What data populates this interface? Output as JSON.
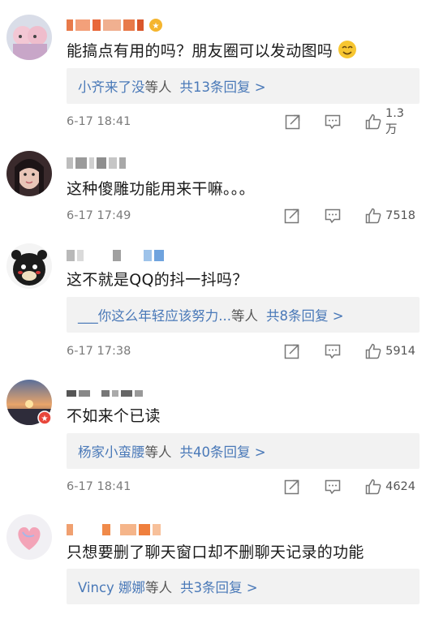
{
  "comments": [
    {
      "text": "能搞点有用的吗？朋友圈可以发动图吗",
      "has_emoji": true,
      "reply_users": "小齐来了没",
      "reply_suffix": "等人",
      "reply_count": "共13条回复 >",
      "time": "6-17 18:41",
      "likes": "1.3万"
    },
    {
      "text": "这种傻雕功能用来干嘛。。。",
      "has_emoji": false,
      "reply_users": "",
      "reply_suffix": "",
      "reply_count": "",
      "time": "6-17 17:49",
      "likes": "7518"
    },
    {
      "text": "这不就是QQ的抖一抖吗？",
      "has_emoji": false,
      "reply_users": "___你这么年轻应该努力...",
      "reply_suffix": "等人",
      "reply_count": "共8条回复 >",
      "time": "6-17 17:38",
      "likes": "5914"
    },
    {
      "text": "不如来个已读",
      "has_emoji": false,
      "reply_users": "杨家小蛮腰",
      "reply_suffix": "等人",
      "reply_count": "共40条回复 >",
      "time": "6-17 18:41",
      "likes": "4624"
    },
    {
      "text": "只想要删了聊天窗口却不删聊天记录的功能",
      "has_emoji": false,
      "reply_users": "Vincy 娜娜",
      "reply_suffix": "等人",
      "reply_count": "共3条回复 >",
      "time": "",
      "likes": ""
    }
  ],
  "icons": {
    "share": "share-icon",
    "comment": "comment-icon",
    "like": "thumbs-up-icon"
  },
  "colors": {
    "link": "#4a79b8",
    "reply_bg": "#f2f2f2",
    "meta": "#7a7a7a"
  }
}
